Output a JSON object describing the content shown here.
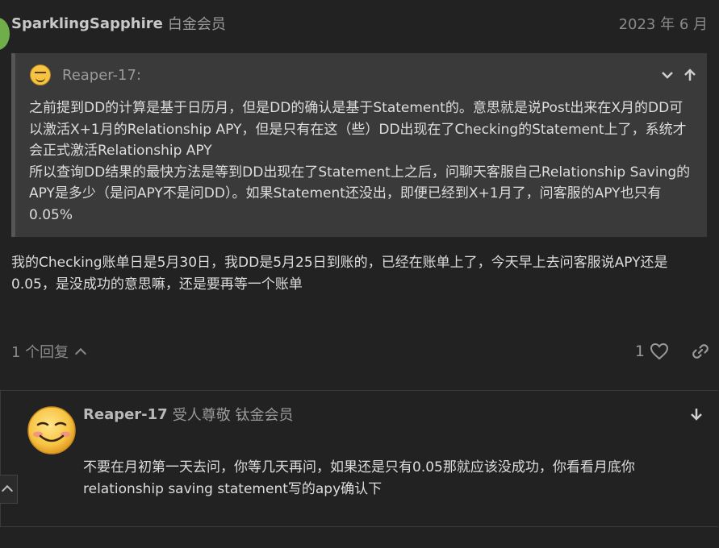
{
  "post": {
    "username": "SparklingSapphire",
    "user_title": "白金会员",
    "date": "2023 年 6 月",
    "quote": {
      "author": "Reaper-17:",
      "avatar_icon": "smiley-face-icon",
      "expand_icon": "chevron-down-icon",
      "jump_icon": "arrow-up-icon",
      "paragraphs": [
        "之前提到DD的计算是基于日历月，但是DD的确认是基于Statement的。意思就是说Post出来在X月的DD可以激活X+1月的Relationship APY，但是只有在这（些）DD出现在了Checking的Statement上了，系统才会正式激活Relationship APY",
        "所以查询DD结果的最快方法是等到DD出现在了Statement上之后，问聊天客服自己Relationship Saving的APY是多少（是问APY不是问DD）。如果Statement还没出，即便已经到X+1月了，问客服的APY也只有0.05%"
      ]
    },
    "body": "我的Checking账单日是5月30日，我DD是5月25日到账的，已经在账单上了，今天早上去问客服说APY还是0.05，是没成功的意思嘛，还是要再等一个账单",
    "replies_label": "1 个回复",
    "like_count": "1",
    "icons": {
      "replies_toggle": "chevron-up-icon",
      "like": "heart-icon",
      "share": "link-icon"
    }
  },
  "reply": {
    "username": "Reaper-17",
    "user_title": "受人尊敬 钛金会员",
    "avatar_icon": "smiley-face-icon",
    "jump_icon": "arrow-down-icon",
    "body": "不要在月初第一天去问，你等几天再问，如果还是只有0.05那就应该没成功，你看看月底你relationship saving statement写的apy确认下"
  },
  "scroll_button_icon": "chevron-up-icon",
  "colors": {
    "background": "#222222",
    "quote_background": "#3a3a3a",
    "text": "#dddddd",
    "muted": "#9a9a9a"
  }
}
